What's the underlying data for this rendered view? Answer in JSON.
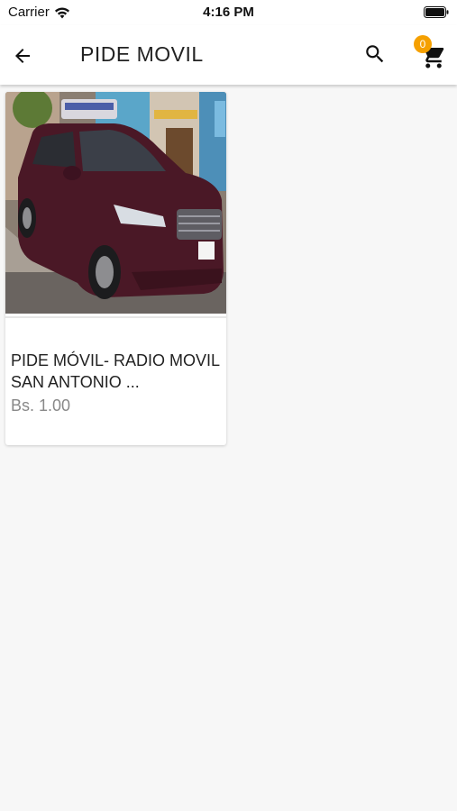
{
  "status_bar": {
    "carrier": "Carrier",
    "time": "4:16 PM",
    "wifi_icon": "wifi-icon",
    "battery_icon": "battery-full-icon"
  },
  "app_bar": {
    "title": "PIDE MOVIL",
    "back_icon": "arrow-left-icon",
    "search_icon": "search-icon",
    "cart_icon": "shopping-cart-icon",
    "cart_count": "0",
    "badge_color": "#f5a000"
  },
  "products": [
    {
      "name": "PIDE MÓVIL- RADIO MOVIL SAN ANTONIO ...",
      "price": "Bs. 1.00",
      "image": "maroon-minivan-taxi-photo"
    }
  ],
  "colors": {
    "background": "#f7f7f7",
    "card": "#ffffff",
    "price_text": "#888888",
    "car_body": "#4a1826"
  }
}
